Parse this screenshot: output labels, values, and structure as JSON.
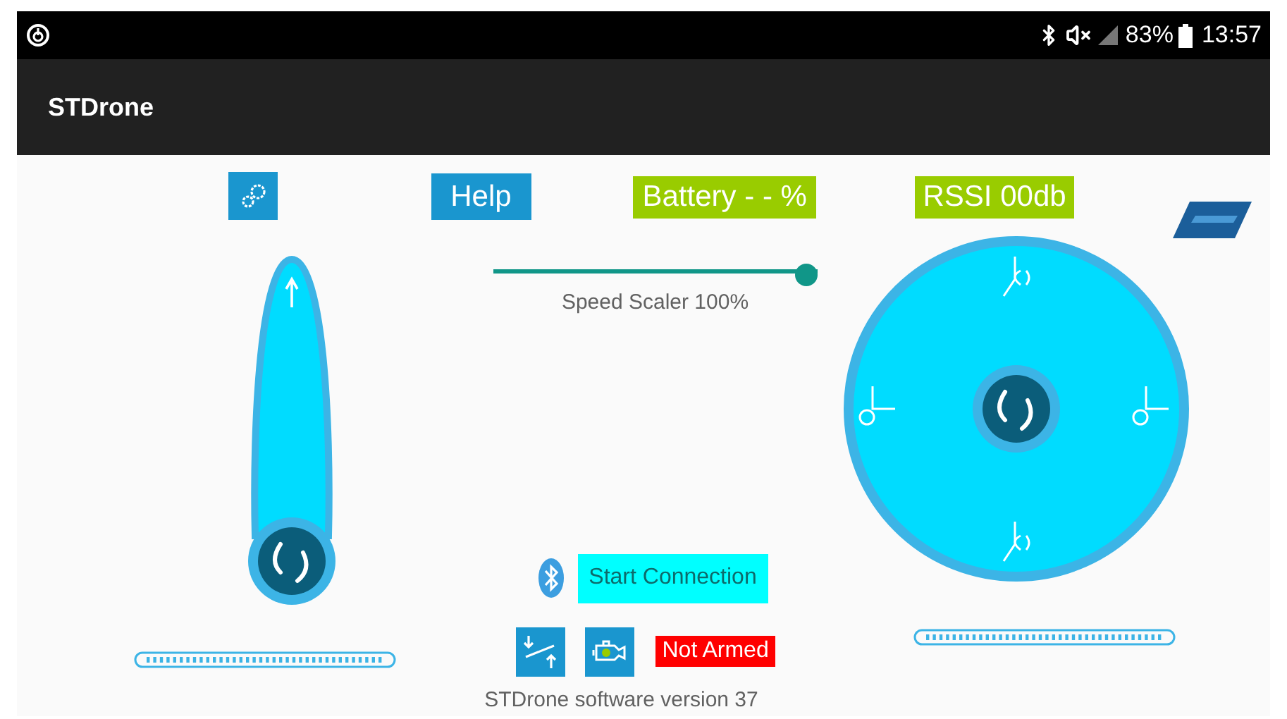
{
  "status_bar": {
    "battery": "83%",
    "time": "13:57"
  },
  "app_bar": {
    "title": "STDrone"
  },
  "top_buttons": {
    "help": "Help",
    "battery": "Battery - - %",
    "rssi": "RSSI 00db"
  },
  "speed_slider": {
    "level": 1.0,
    "label": "Speed Scaler 100%"
  },
  "trims": [
    {
      "level": 1
    },
    {
      "level": 1
    }
  ],
  "connection": {
    "button": "Start Connection"
  },
  "arm_status": {
    "label": "Not Armed",
    "armed": false
  },
  "footer": {
    "version": "STDrone software version 37"
  }
}
